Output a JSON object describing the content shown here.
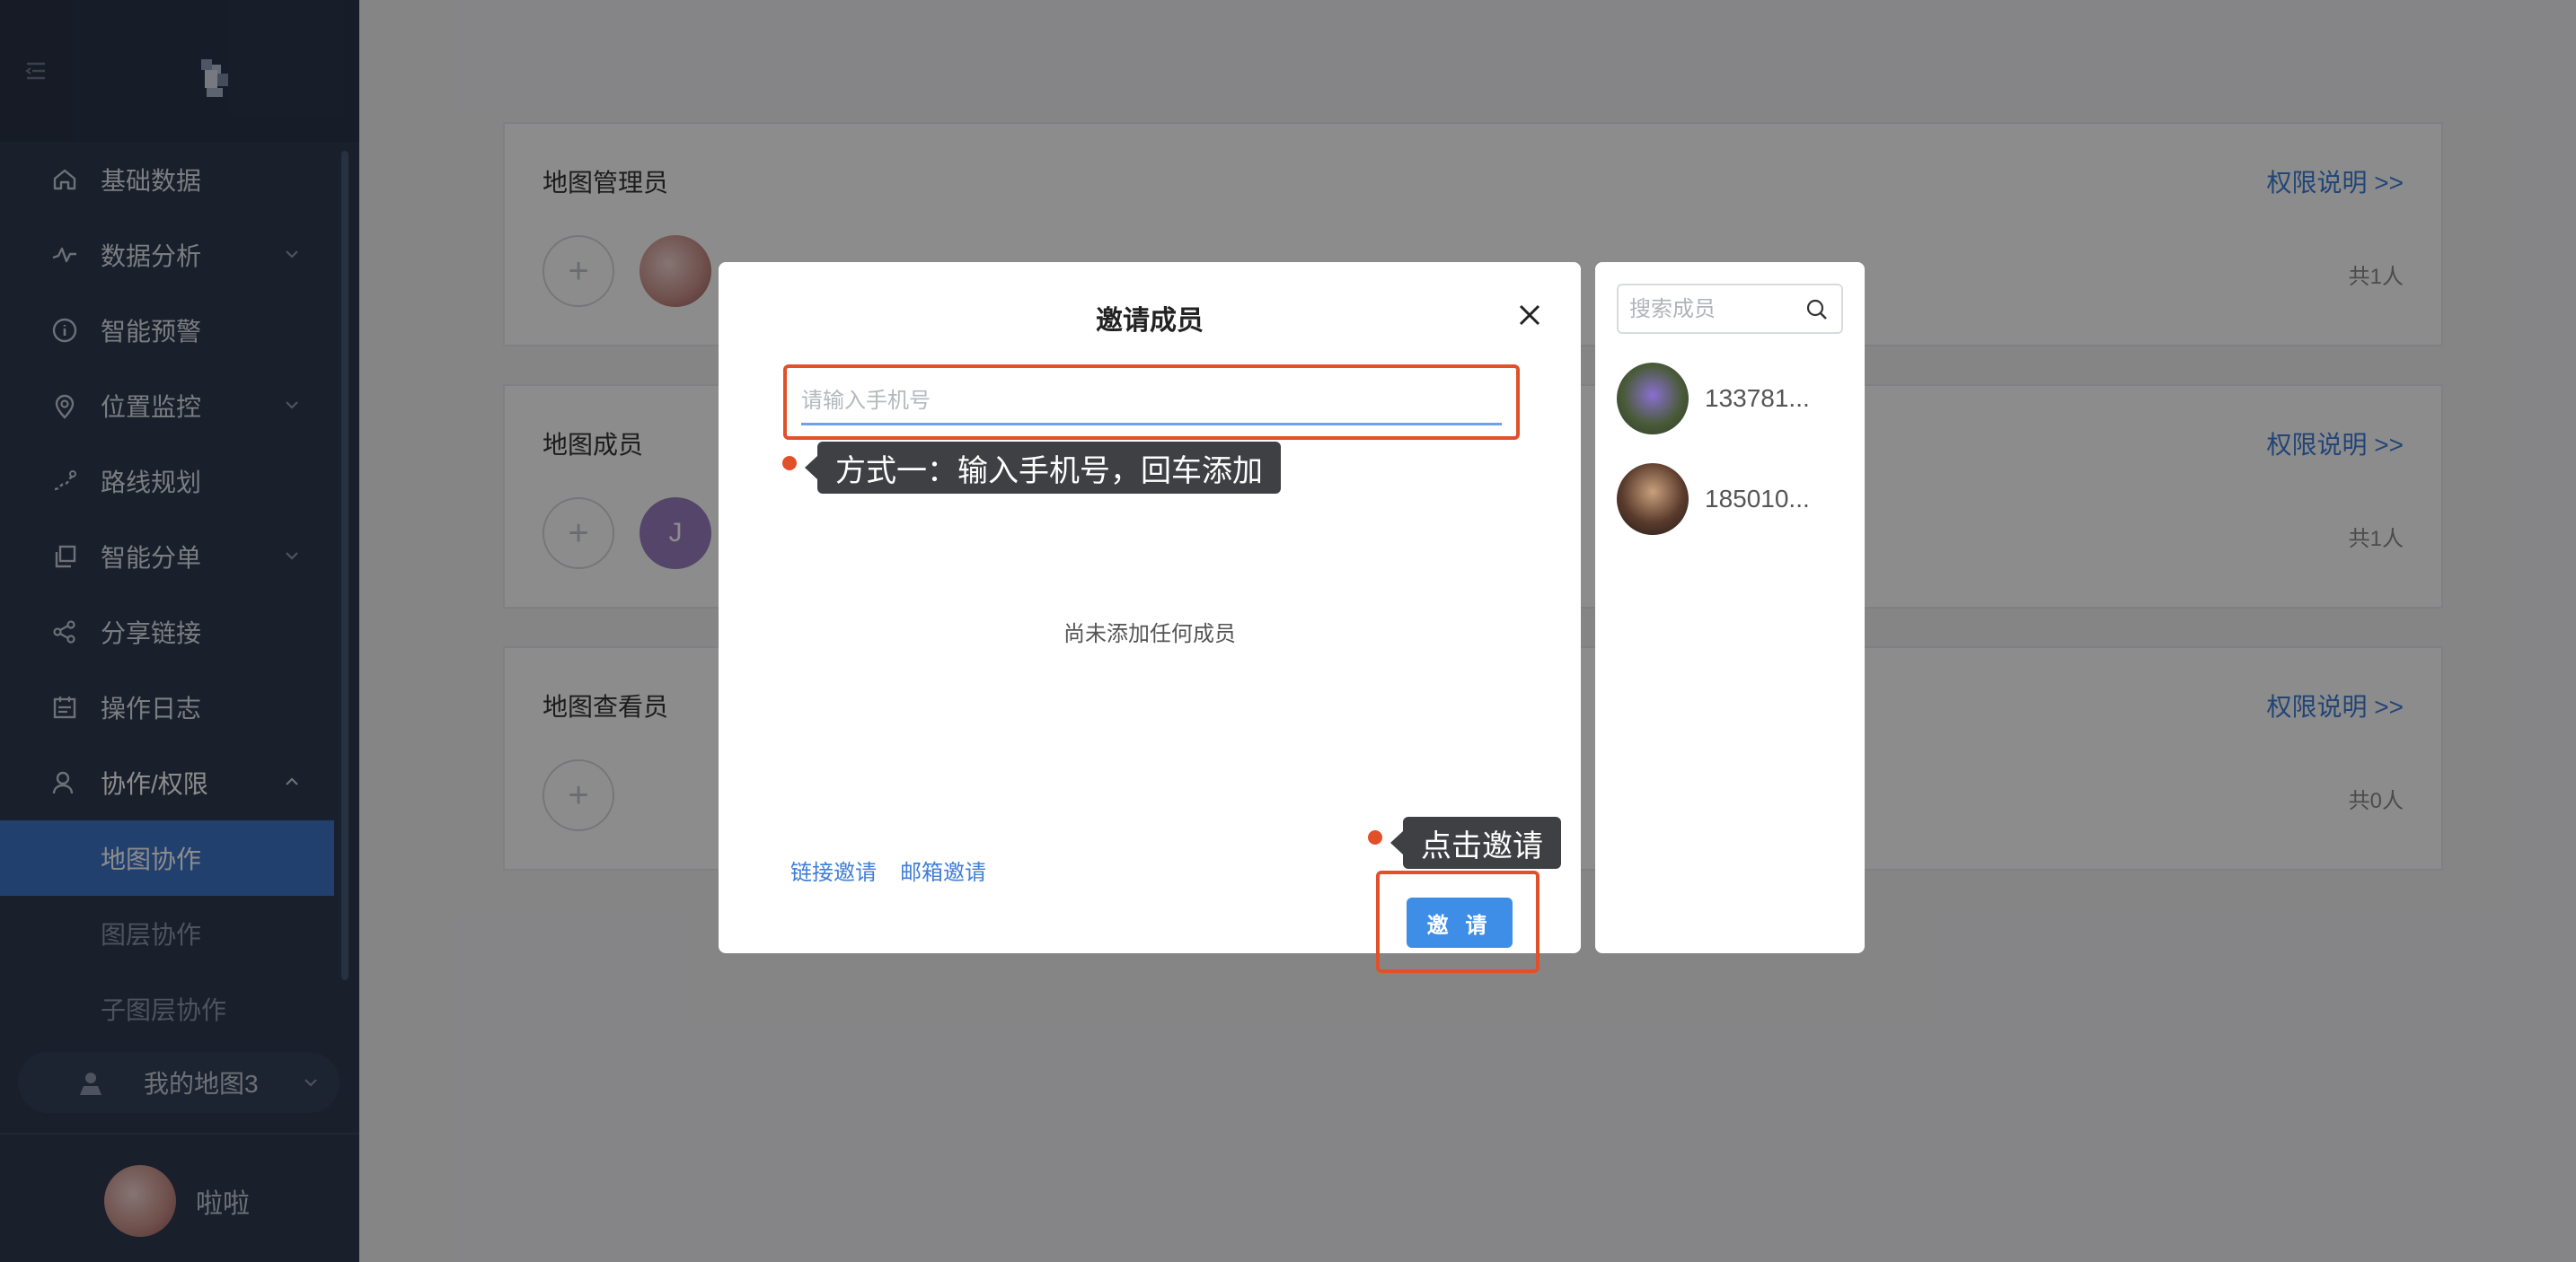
{
  "sidebar": {
    "items": [
      {
        "label": "基础数据",
        "icon": "home-icon",
        "chevron": false
      },
      {
        "label": "数据分析",
        "icon": "activity-icon",
        "chevron": true
      },
      {
        "label": "智能预警",
        "icon": "info-icon",
        "chevron": false
      },
      {
        "label": "位置监控",
        "icon": "location-icon",
        "chevron": true
      },
      {
        "label": "路线规划",
        "icon": "route-icon",
        "chevron": false
      },
      {
        "label": "智能分单",
        "icon": "copy-icon",
        "chevron": true
      },
      {
        "label": "分享链接",
        "icon": "share-icon",
        "chevron": false
      },
      {
        "label": "操作日志",
        "icon": "calendar-icon",
        "chevron": false
      },
      {
        "label": "协作/权限",
        "icon": "user-icon",
        "chevron": true,
        "expanded": true
      }
    ],
    "subitems": [
      {
        "label": "地图协作",
        "active": true
      },
      {
        "label": "图层协作",
        "active": false
      },
      {
        "label": "子图层协作",
        "active": false
      }
    ],
    "map_select": "我的地图3",
    "user_name": "啦啦"
  },
  "cards": [
    {
      "title": "地图管理员",
      "link": "权限说明 >>",
      "count": "共1人"
    },
    {
      "title": "地图成员",
      "link": "权限说明 >>",
      "count": "共1人",
      "member_initial": "J"
    },
    {
      "title": "地图查看员",
      "link": "权限说明 >>",
      "count": "共0人"
    }
  ],
  "dialog": {
    "title": "邀请成员",
    "phone_placeholder": "请输入手机号",
    "empty_text": "尚未添加任何成员",
    "link_invite": "链接邀请",
    "email_invite": "邮箱邀请",
    "invite_button": "邀 请"
  },
  "tips": {
    "method_one": "方式一：输入手机号，回车添加",
    "click_invite": "点击邀请"
  },
  "side_panel": {
    "search_placeholder": "搜索成员",
    "members": [
      {
        "name": "133781..."
      },
      {
        "name": "185010..."
      }
    ]
  },
  "colors": {
    "accent": "#3e8ee8",
    "highlight": "#e2502a",
    "sidebar_bg": "#2e3a4f",
    "active_nav": "#3f76c9"
  }
}
